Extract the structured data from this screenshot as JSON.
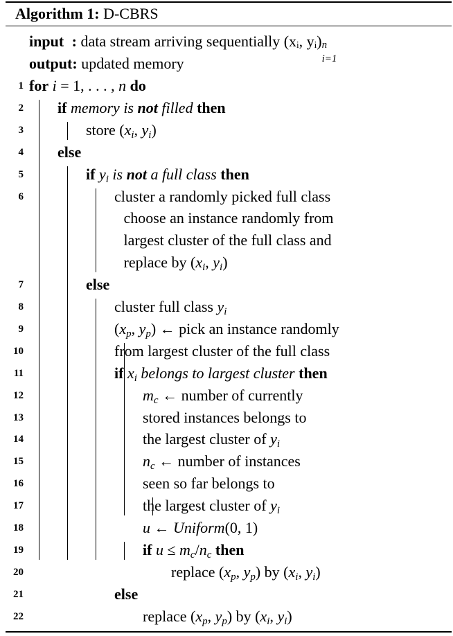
{
  "algorithm": {
    "caption_label": "Algorithm 1:",
    "caption_name": "D-CBRS",
    "input_keyword": "input",
    "input_colon": ":",
    "input_text": "data stream arriving sequentially",
    "input_math": "(xᵢ, yᵢ)",
    "input_sup": "n",
    "input_sub": "i=1",
    "output_keyword": "output:",
    "output_text": "updated memory",
    "lines": [
      {
        "num": "1",
        "indent": 0,
        "html": "<b>for</b> <i>i</i> = 1, . . . , <i>n</i> <b>do</b>"
      },
      {
        "num": "2",
        "indent": 1,
        "html": "<b>if</b> <i>memory is</i> <b><i>not</i></b> <i>filled</i> <b>then</b>"
      },
      {
        "num": "3",
        "indent": 2,
        "html": "store (<i>x</i><span class=\"sub\">i</span>, <i>y</i><span class=\"sub\">i</span>)"
      },
      {
        "num": "4",
        "indent": 1,
        "html": "<b>else</b>"
      },
      {
        "num": "5",
        "indent": 2,
        "html": "<b>if</b> <i>y</i><span class=\"sub\">i</span> <i>is</i> <b><i>not</i></b> <i>a full class</i> <b>then</b>"
      },
      {
        "num": "6",
        "indent": 3,
        "html": "cluster a randomly picked full class"
      },
      {
        "num": "",
        "indent": 3.33,
        "html": "choose an instance randomly from"
      },
      {
        "num": "",
        "indent": 3.33,
        "html": "largest cluster of the full class and"
      },
      {
        "num": "",
        "indent": 3.33,
        "html": "replace by (<i>x</i><span class=\"sub\">i</span>, <i>y</i><span class=\"sub\">i</span>)"
      },
      {
        "num": "7",
        "indent": 2,
        "html": "<b>else</b>"
      },
      {
        "num": "8",
        "indent": 3,
        "html": "cluster full class <i>y</i><span class=\"sub\">i</span>"
      },
      {
        "num": "9",
        "indent": 3,
        "html": "(<i>x</i><span class=\"sub\">p</span>, <i>y</i><span class=\"sub\">p</span>) ← pick an instance randomly"
      },
      {
        "num": "10",
        "indent": 3,
        "html": "from largest cluster of the full class"
      },
      {
        "num": "11",
        "indent": 3,
        "html": "<b>if</b> <i>x</i><span class=\"sub\">i</span> <i>belongs to largest cluster</i> <b>then</b>"
      },
      {
        "num": "12",
        "indent": 4,
        "html": "<i>m</i><span class=\"sub\">c</span> ← number of currently"
      },
      {
        "num": "13",
        "indent": 4,
        "html": "stored instances belongs to"
      },
      {
        "num": "14",
        "indent": 4,
        "html": "the largest cluster of <i>y</i><span class=\"sub\">i</span>"
      },
      {
        "num": "15",
        "indent": 4,
        "html": "<i>n</i><span class=\"sub\">c</span> ← number of instances"
      },
      {
        "num": "16",
        "indent": 4,
        "html": "seen so far belongs to"
      },
      {
        "num": "17",
        "indent": 4,
        "html": "the largest cluster of <i>y</i><span class=\"sub\">i</span>"
      },
      {
        "num": "18",
        "indent": 4,
        "html": "<i>u</i> ← <i>Uniform</i>(0, 1)"
      },
      {
        "num": "19",
        "indent": 4,
        "html": "<b>if</b> <i>u</i> ≤ <i>m</i><span class=\"sub\">c</span>/<i>n</i><span class=\"sub\">c</span> <b>then</b>"
      },
      {
        "num": "20",
        "indent": 5,
        "html": "replace (<i>x</i><span class=\"sub\">p</span>, <i>y</i><span class=\"sub\">p</span>) by (<i>x</i><span class=\"sub\">i</span>, <i>y</i><span class=\"sub\">i</span>)"
      },
      {
        "num": "21",
        "indent": 3,
        "html": "<b>else</b>"
      },
      {
        "num": "22",
        "indent": 4,
        "html": "replace (<i>x</i><span class=\"sub\">p</span>, <i>y</i><span class=\"sub\">p</span>) by (<i>x</i><span class=\"sub\">i</span>, <i>y</i><span class=\"sub\">i</span>)"
      }
    ]
  }
}
